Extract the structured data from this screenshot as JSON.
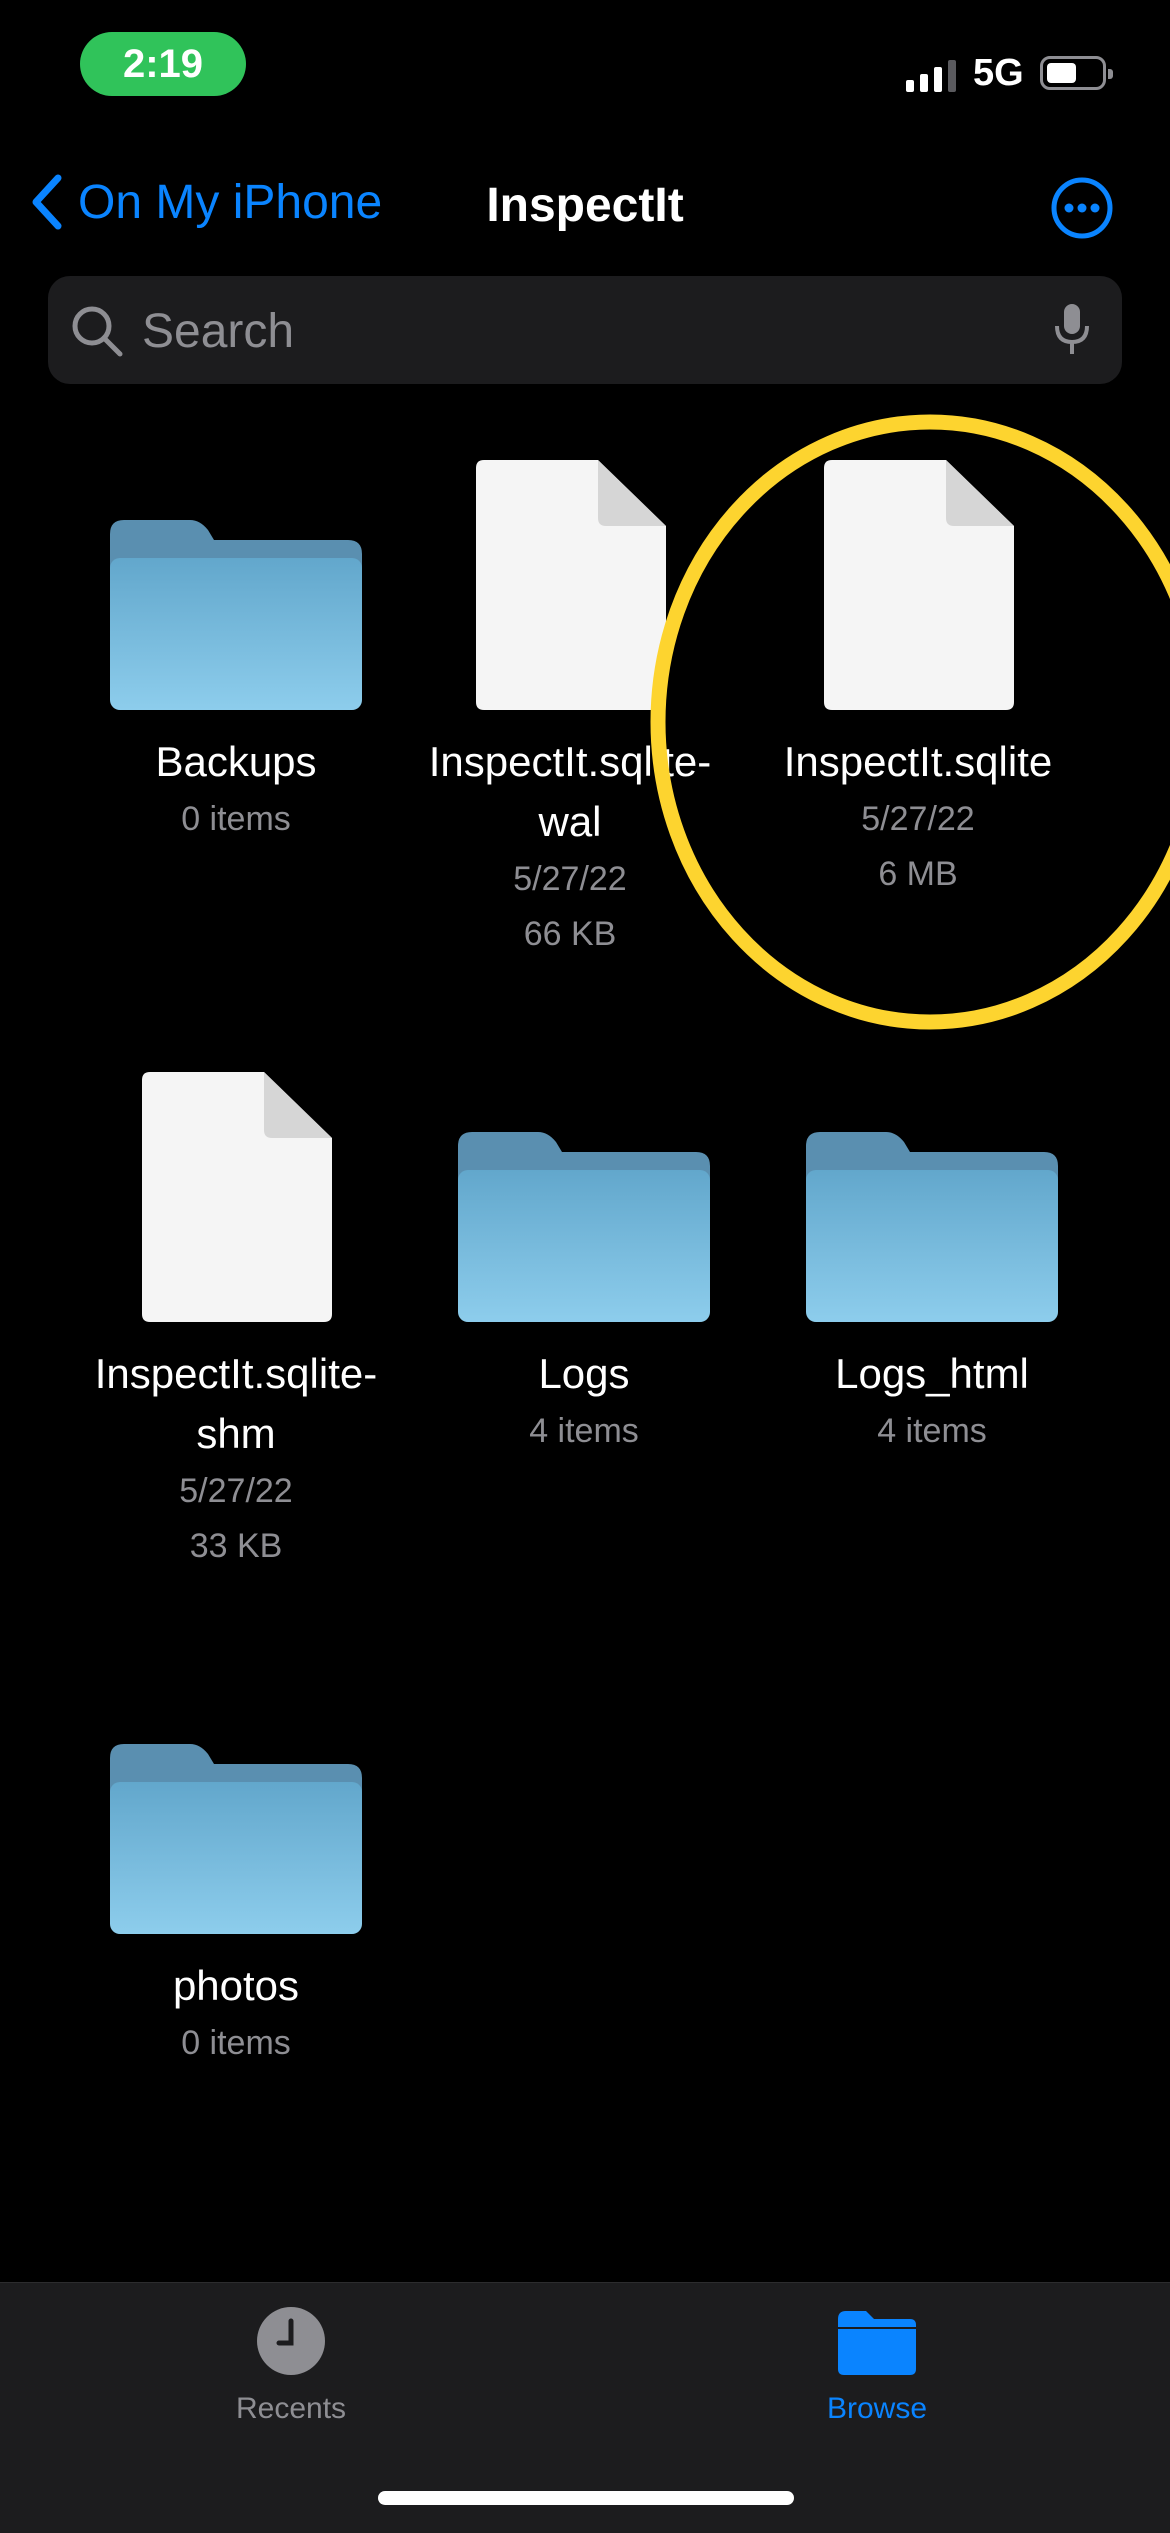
{
  "status_bar": {
    "time": "2:19",
    "network": "5G",
    "battery_level_fraction": 0.55
  },
  "nav": {
    "back_label": "On My iPhone",
    "title": "InspectIt"
  },
  "search": {
    "placeholder": "Search"
  },
  "items": [
    {
      "kind": "folder",
      "name": "Backups",
      "meta1": "0 items",
      "meta2": ""
    },
    {
      "kind": "file",
      "name": "InspectIt.sqlite-wal",
      "meta1": "5/27/22",
      "meta2": "66 KB"
    },
    {
      "kind": "file",
      "name": "InspectIt.sqlite",
      "meta1": "5/27/22",
      "meta2": "6 MB"
    },
    {
      "kind": "file",
      "name": "InspectIt.sqlite-shm",
      "meta1": "5/27/22",
      "meta2": "33 KB"
    },
    {
      "kind": "folder",
      "name": "Logs",
      "meta1": "4 items",
      "meta2": ""
    },
    {
      "kind": "folder",
      "name": "Logs_html",
      "meta1": "4 items",
      "meta2": ""
    },
    {
      "kind": "folder",
      "name": "photos",
      "meta1": "0 items",
      "meta2": ""
    }
  ],
  "tabs": {
    "recents": "Recents",
    "browse": "Browse"
  },
  "colors": {
    "accent": "#0a84ff",
    "highlight": "#fdd42f",
    "time_pill": "#30c35a"
  }
}
